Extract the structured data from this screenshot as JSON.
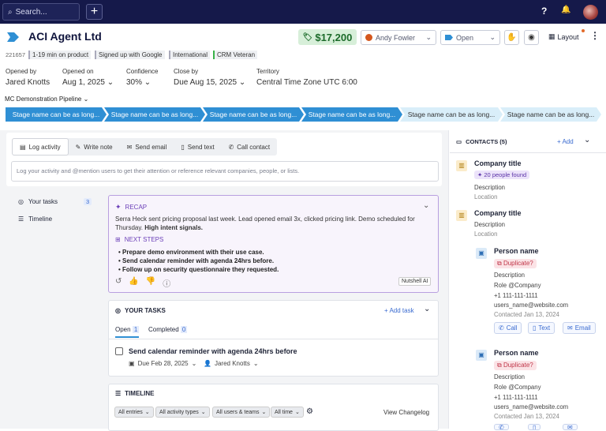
{
  "topbar": {
    "search_placeholder": "Search...",
    "plus": "+",
    "help": "?",
    "bell": "🔔"
  },
  "header": {
    "title": "ACI Agent Ltd",
    "amount": "$17,200",
    "owner": "Andy Fowler",
    "status": "Open",
    "layout": "Layout"
  },
  "tags": {
    "id": "221657",
    "items": [
      "1-19 min on product",
      "Signed up with Google",
      "International",
      "CRM Veteran"
    ]
  },
  "fields": [
    {
      "label": "Opened by",
      "value": "Jared Knotts"
    },
    {
      "label": "Opened on",
      "value": "Aug 1, 2025"
    },
    {
      "label": "Confidence",
      "value": "30%"
    },
    {
      "label": "Close by",
      "value": "Due Aug 15, 2025"
    },
    {
      "label": "Territory",
      "value": "Central Time Zone UTC 6:00"
    }
  ],
  "pipeline": {
    "name": "MC Demonstration Pipeline",
    "stages": [
      "Stage name can be as long...",
      "Stage name can be as long...",
      "Stage name can be as long...",
      "Stage name can be as long...",
      "Stage name can be as long...",
      "Stage name can be as long..."
    ]
  },
  "activity": {
    "tabs": [
      "Log activity",
      "Write note",
      "Send email",
      "Send text",
      "Call contact"
    ],
    "placeholder": "Log your activity and @mention users to get their attention or reference relevant companies, people, or lists."
  },
  "nav": {
    "tasks": "Your tasks",
    "tasks_count": "3",
    "timeline": "Timeline"
  },
  "recap": {
    "title": "RECAP",
    "text": "Serra Heck sent pricing proposal last week. Lead opened email 3x, clicked pricing link. Demo scheduled for Thursday.",
    "strong": "High intent signals.",
    "next_title": "NEXT STEPS",
    "steps": [
      "Prepare demo environment with their use case.",
      "Send calendar reminder with agenda 24hrs before.",
      "Follow up on security questionnaire they requested."
    ],
    "badge": "Nutshell AI"
  },
  "tasks": {
    "title": "YOUR TASKS",
    "add": "+ Add task",
    "open": "Open",
    "open_count": "1",
    "completed": "Completed",
    "completed_count": "0",
    "task_title": "Send calendar reminder with agenda 24hrs before",
    "due": "Due Feb 28, 2025",
    "assignee": "Jared Knotts"
  },
  "timeline": {
    "title": "TIMELINE",
    "filters": [
      "All entries",
      "All activity types",
      "All users & teams",
      "All time"
    ],
    "changelog": "View Changelog"
  },
  "contacts": {
    "title": "CONTACTS (5)",
    "add": "+ Add",
    "companies": [
      {
        "name": "Company title",
        "badge": "20 people found",
        "description": "Description",
        "location": "Location"
      },
      {
        "name": "Company title",
        "description": "Description",
        "location": "Location"
      }
    ],
    "people": [
      {
        "name": "Person name",
        "badge": "Duplicate?",
        "description": "Description",
        "role": "Role @Company",
        "phone": "+1 111-111-1111",
        "email": "users_name@website.com",
        "contacted": "Contacted Jan 13, 2024"
      },
      {
        "name": "Person name",
        "badge": "Duplicate?",
        "description": "Description",
        "role": "Role @Company",
        "phone": "+1 111-111-1111",
        "email": "users_name@website.com",
        "contacted": "Contacted Jan 13, 2024"
      }
    ],
    "actions": [
      "Call",
      "Text",
      "Email"
    ]
  },
  "colors": {
    "topbar": "#15194a",
    "stage_active": "#2f8fd4",
    "stage_inactive": "#d9eef9",
    "amount_bg": "#d7efd9",
    "ai_purple": "#6b3fb8"
  }
}
